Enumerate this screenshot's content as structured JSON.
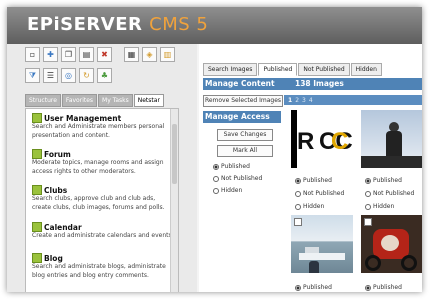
{
  "brand": {
    "name": "EPiSERVER",
    "product": "CMS 5"
  },
  "left_tabs": [
    {
      "label": "Structure",
      "active": false
    },
    {
      "label": "Favorites",
      "active": false
    },
    {
      "label": "My Tasks",
      "active": false
    },
    {
      "label": "Netstar",
      "active": true
    }
  ],
  "widgets": [
    {
      "title": "User Management",
      "desc": "Search and Administrate members personal presentation and content."
    },
    {
      "title": "Forum",
      "desc": "Moderate topics, manage rooms and assign access rights to other moderators."
    },
    {
      "title": "Clubs",
      "desc": "Search clubs, approve club and club ads, create clubs, club images, forums and polls."
    },
    {
      "title": "Calendar",
      "desc": "Create and administrate calendars and events."
    },
    {
      "title": "Blog",
      "desc": "Search and administrate blogs, administrate blog entries and blog entry comments."
    }
  ],
  "right_tabs": [
    {
      "label": "Search Images",
      "active": false
    },
    {
      "label": "Published",
      "active": true
    },
    {
      "label": "Not Published",
      "active": false
    },
    {
      "label": "Hidden",
      "active": false
    }
  ],
  "manage_content": {
    "title": "Manage Content",
    "count": "138 Images"
  },
  "remove_button": "Remove Selected Images",
  "pager": [
    "1",
    "2",
    "3",
    "4"
  ],
  "manage_access": {
    "title": "Manage Access",
    "save": "Save Changes",
    "mark_all": "Mark All",
    "options": [
      "Published",
      "Not Published",
      "Hidden"
    ],
    "selected": "Published"
  },
  "image_options": [
    "Published",
    "Not Published",
    "Hidden"
  ],
  "image_partial_text": "R CC",
  "colors": {
    "accent": "#4f83b6",
    "brand_orange": "#f0a23c",
    "widget_icon": "#9ac23c"
  }
}
